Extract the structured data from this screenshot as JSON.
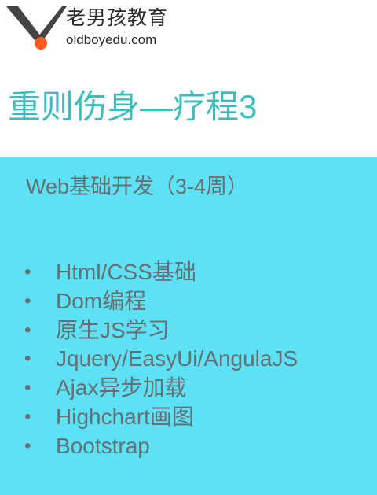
{
  "header": {
    "logo_cn": "老男孩教育",
    "logo_en": "oldboyedu.com",
    "title": "重则伤身—疗程3"
  },
  "content": {
    "subtitle": "Web基础开发（3-4周）",
    "bullet_symbol": "•",
    "items": [
      "Html/CSS基础",
      "Dom编程",
      "原生JS学习",
      "Jquery/EasyUi/AngulaJS",
      "Ajax异步加载",
      "Highchart画图",
      "Bootstrap"
    ]
  },
  "colors": {
    "title": "#3bbdbd",
    "content_background": "#5ce1f5",
    "body_text": "#666f73",
    "logo_dot": "#ff5a1f"
  }
}
